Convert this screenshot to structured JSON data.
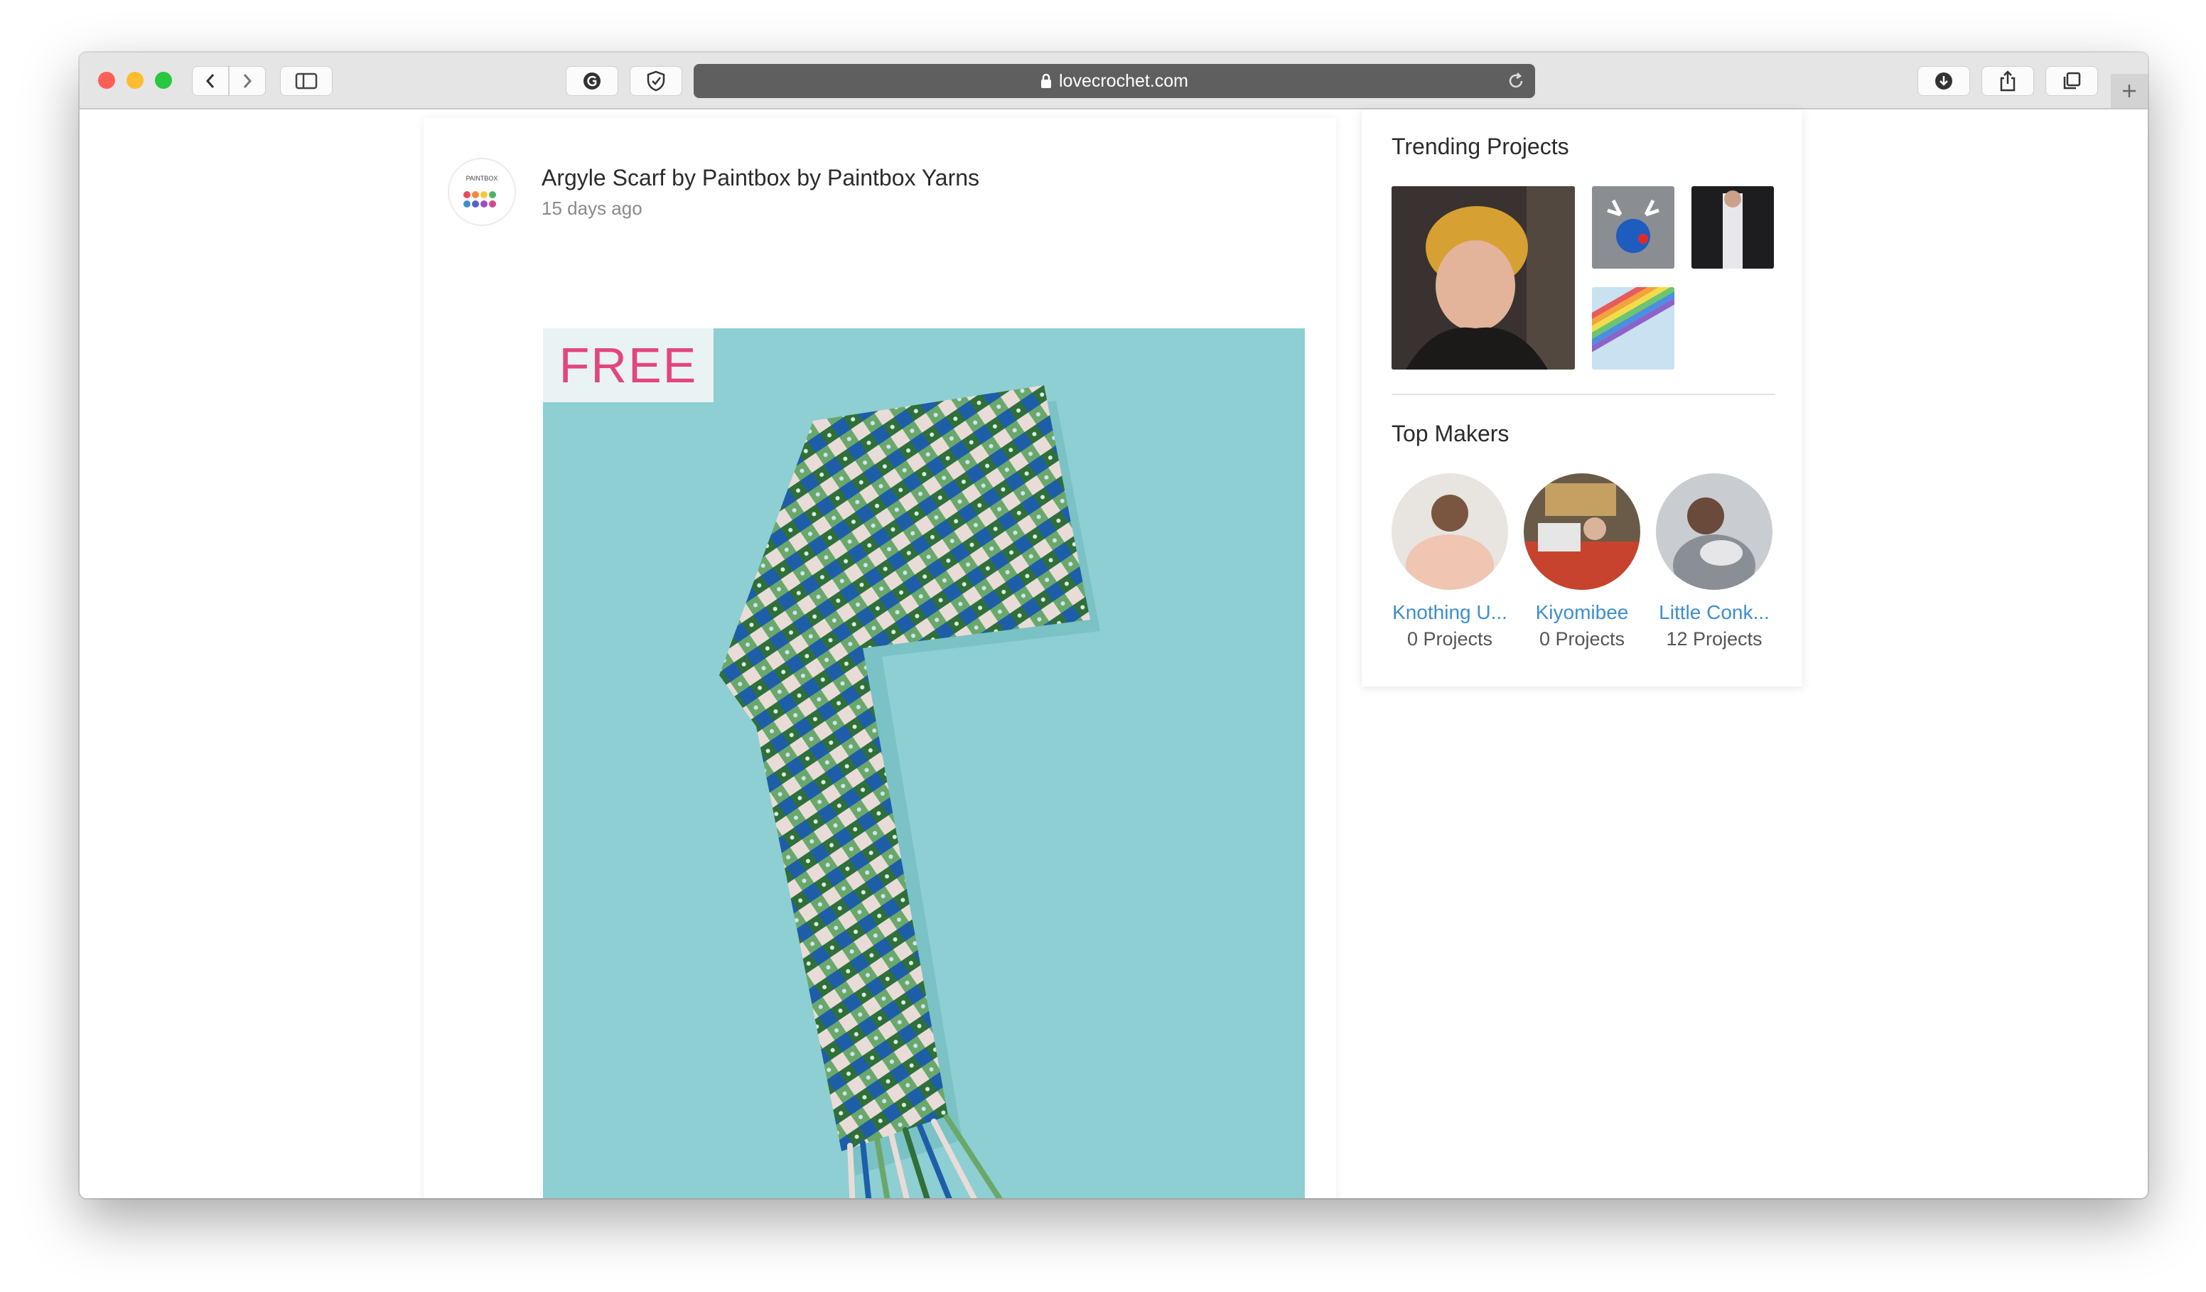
{
  "browser": {
    "url": "lovecrochet.com",
    "icons": {
      "close": "close-traffic-light",
      "minimize": "minimize-traffic-light",
      "zoom": "zoom-traffic-light",
      "back": "chevron-left-icon",
      "forward": "chevron-right-icon",
      "sidebar": "sidebar-icon",
      "grammarly": "grammarly-icon",
      "shield": "shield-icon",
      "lock": "lock-icon",
      "reload": "reload-icon",
      "download": "download-icon",
      "share": "share-icon",
      "tabs": "tabs-icon",
      "new_tab": "plus-icon"
    },
    "colors": {
      "close": "#fe5f57",
      "minimize": "#febc2e",
      "zoom": "#28c840"
    }
  },
  "post": {
    "brand_logo_text": "PAINTBOX",
    "title": "Argyle Scarf by Paintbox by Paintbox Yarns",
    "time": "15 days ago",
    "badge": "FREE",
    "badge_color": "#e2467f",
    "image_bg": "#8ecfd3"
  },
  "sidebar": {
    "trending_title": "Trending Projects",
    "makers_title": "Top Makers",
    "makers": [
      {
        "name": "Knothing U...",
        "projects": "0 Projects"
      },
      {
        "name": "Kiyomibee",
        "projects": "0 Projects"
      },
      {
        "name": "Little Conk...",
        "projects": "12 Projects"
      }
    ],
    "link_color": "#3d8ecf"
  }
}
